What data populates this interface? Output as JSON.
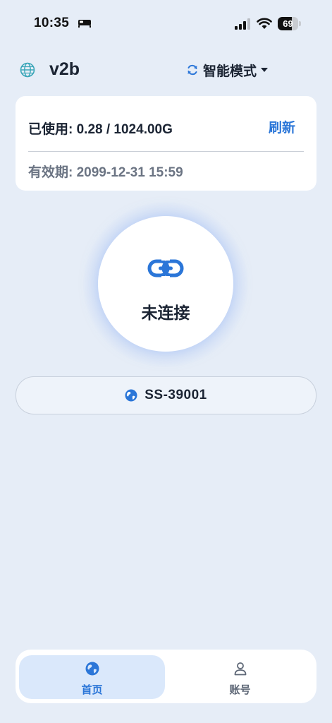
{
  "status_bar": {
    "time": "10:35",
    "battery_level": "69",
    "battery_fraction": 0.69
  },
  "header": {
    "title": "v2b",
    "mode_label": "智能模式",
    "icons": [
      "globe-icon",
      "sync-icon",
      "chevron-down-icon"
    ]
  },
  "usage": {
    "label": "已使用: ",
    "value": "0.28 / 1024.00G",
    "refresh_label": "刷新",
    "expire_label": "有效期: ",
    "expire_value": "2099-12-31 15:59"
  },
  "connect": {
    "status": "未连接",
    "icon": "link-icon"
  },
  "server": {
    "name": "SS-39001",
    "icon": "earth-icon"
  },
  "nav": {
    "home_label": "首页",
    "account_label": "账号",
    "active": "home"
  },
  "colors": {
    "background": "#e6edf7",
    "accent": "#2b76d8",
    "text": "#1b2433",
    "muted": "#6b7483",
    "card": "#ffffff"
  }
}
